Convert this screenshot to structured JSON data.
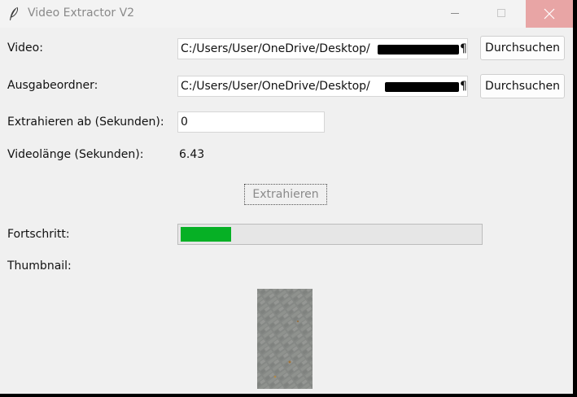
{
  "window": {
    "title": "Video Extractor V2"
  },
  "form": {
    "video_label": "Video:",
    "video_path": "C:/Users/User/OneDrive/Desktop/",
    "video_path_suffix": "¶I",
    "output_label": "Ausgabeordner:",
    "output_path": "C:/Users/User/OneDrive/Desktop/",
    "output_path_suffix": "¶I",
    "browse_label": "Durchsuchen",
    "start_label": "Extrahieren ab (Sekunden):",
    "start_value": "0",
    "length_label": "Videolänge (Sekunden):",
    "length_value": "6.43",
    "extract_label": "Extrahieren",
    "progress_label": "Fortschritt:",
    "progress_value": 0.17,
    "thumbnail_label": "Thumbnail:"
  },
  "colors": {
    "progress_fill": "#06b025",
    "close_button": "#e8a5a5",
    "window_bg": "#f0f0f0"
  },
  "icons": {
    "app": "feather-icon",
    "minimize": "minimize-icon",
    "maximize": "maximize-icon",
    "close": "close-icon"
  }
}
